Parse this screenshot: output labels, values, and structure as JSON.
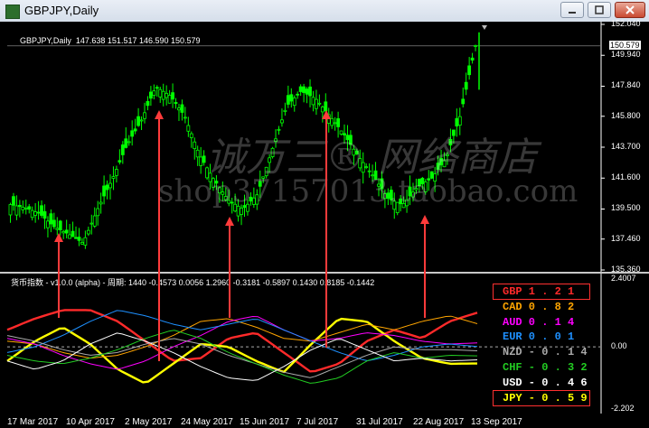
{
  "window": {
    "title": "GBPJPY,Daily"
  },
  "chart_header": {
    "symbol": "GBPJPY,Daily",
    "ohlc": "147.638 151.517 146.590 150.579"
  },
  "price_axis": {
    "ticks": [
      "152.040",
      "149.940",
      "147.840",
      "145.800",
      "143.700",
      "141.600",
      "139.500",
      "137.460",
      "135.360"
    ],
    "current_price": "150.579",
    "current_price_color": "#ffffff"
  },
  "indicator": {
    "label": "货币指数 - v1.0.0 (alpha) - 周期: 1440 -0.4573 0.0056 1.2960 -0.3181 -0.5897 0.1430 0.8185 -0.1442",
    "axis_ticks": [
      "2.4007",
      "0.00",
      "-2.202"
    ]
  },
  "currency_legend": [
    {
      "code": "GBP",
      "value": "1.21",
      "color": "#ff2a2a",
      "boxed": true
    },
    {
      "code": "CAD",
      "value": "0.82",
      "color": "#ffa500",
      "boxed": false
    },
    {
      "code": "AUD",
      "value": "0.14",
      "color": "#ff00ff",
      "boxed": false
    },
    {
      "code": "EUR",
      "value": "0.01",
      "color": "#1e90ff",
      "boxed": false
    },
    {
      "code": "NZD",
      "value": "-0.14",
      "color": "#aaaaaa",
      "boxed": false
    },
    {
      "code": "CHF",
      "value": "-0.32",
      "color": "#22cc22",
      "boxed": false
    },
    {
      "code": "USD",
      "value": "-0.46",
      "color": "#ffffff",
      "boxed": false
    },
    {
      "code": "JPY",
      "value": "-0.59",
      "color": "#ffff00",
      "boxed": true
    }
  ],
  "x_axis": {
    "labels": [
      "17 Mar 2017",
      "10 Apr 2017",
      "2 May 2017",
      "24 May 2017",
      "15 Jun 2017",
      "7 Jul 2017",
      "31 Jul 2017",
      "22 Aug 2017",
      "13 Sep 2017"
    ]
  },
  "watermark": {
    "line1": "诚万三® 网络商店",
    "line2": "shop37157013.taobao.com"
  },
  "colors": {
    "candle_bull": "#00ff00",
    "candle_bear": "#00ff00",
    "arrow": "#ff3b3b",
    "background": "#000000"
  },
  "chart_data": {
    "type": "line",
    "title": "GBPJPY,Daily",
    "ylim": [
      135.36,
      152.04
    ],
    "price_path": [
      139.8,
      139.6,
      139.2,
      138.3,
      137.8,
      137.2,
      139.5,
      141.5,
      143.8,
      145.5,
      147.8,
      147.2,
      145.8,
      143.2,
      141.5,
      140.1,
      139.5,
      140.5,
      143.5,
      146.5,
      147.5,
      147.0,
      145.8,
      144.5,
      143.0,
      141.7,
      140.2,
      139.8,
      141.0,
      141.6,
      143.0,
      146.0,
      150.6
    ],
    "indicator_ylim": [
      -2.202,
      2.4007
    ],
    "series": [
      {
        "name": "GBP",
        "values": [
          0.6,
          1.0,
          1.3,
          1.3,
          0.9,
          0.2,
          -0.5,
          -0.4,
          0.3,
          0.5,
          -0.2,
          -0.9,
          -0.6,
          0.2,
          0.6,
          0.3,
          0.9,
          1.21
        ]
      },
      {
        "name": "JPY",
        "values": [
          -0.5,
          0.2,
          0.7,
          0.1,
          -0.8,
          -1.3,
          -0.6,
          0.1,
          0.0,
          -0.5,
          -0.9,
          0.1,
          1.0,
          0.9,
          0.2,
          -0.4,
          -0.6,
          -0.59
        ]
      },
      {
        "name": "CAD",
        "values": [
          0.2,
          0.1,
          -0.2,
          -0.4,
          -0.3,
          0.0,
          0.4,
          0.9,
          1.0,
          0.7,
          0.3,
          0.2,
          0.5,
          0.8,
          0.6,
          0.9,
          1.1,
          0.82
        ]
      },
      {
        "name": "AUD",
        "values": [
          0.3,
          0.1,
          -0.3,
          -0.6,
          -0.8,
          -0.5,
          0.0,
          0.4,
          0.9,
          1.1,
          0.6,
          0.2,
          0.3,
          0.5,
          0.4,
          0.2,
          0.1,
          0.14
        ]
      },
      {
        "name": "EUR",
        "values": [
          -0.2,
          0.0,
          0.4,
          0.9,
          1.3,
          1.1,
          0.8,
          0.6,
          0.8,
          1.0,
          0.6,
          0.2,
          -0.2,
          -0.5,
          -0.3,
          0.0,
          0.1,
          0.01
        ]
      },
      {
        "name": "NZD",
        "values": [
          0.4,
          0.2,
          -0.1,
          -0.3,
          -0.2,
          0.1,
          0.3,
          0.1,
          -0.3,
          -0.6,
          -0.9,
          -1.1,
          -0.7,
          -0.3,
          0.0,
          -0.1,
          -0.1,
          -0.14
        ]
      },
      {
        "name": "CHF",
        "values": [
          -0.3,
          -0.5,
          -0.6,
          -0.4,
          -0.1,
          0.3,
          0.6,
          0.3,
          -0.2,
          -0.6,
          -1.0,
          -1.3,
          -1.1,
          -0.5,
          -0.2,
          -0.4,
          -0.3,
          -0.32
        ]
      },
      {
        "name": "USD",
        "values": [
          -0.5,
          -0.8,
          -0.5,
          0.1,
          0.5,
          0.2,
          -0.2,
          -0.7,
          -1.1,
          -1.2,
          -0.7,
          -0.1,
          0.3,
          -0.1,
          -0.5,
          -0.4,
          -0.5,
          -0.46
        ]
      }
    ],
    "arrows_at_x": [
      "2017-03-31",
      "2017-05-04",
      "2017-06-14",
      "2017-07-12",
      "2017-08-28"
    ]
  }
}
